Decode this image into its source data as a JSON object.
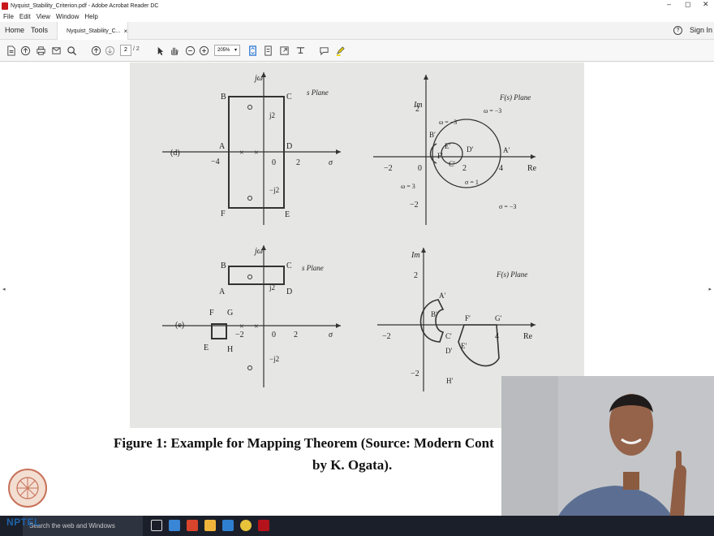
{
  "window": {
    "title": "Nyquist_Stability_Criterion.pdf - Adobe Acrobat Reader DC",
    "controls": {
      "minimize": "–",
      "maximize": "◻",
      "close": "✕"
    }
  },
  "menu": {
    "items": [
      "File",
      "Edit",
      "View",
      "Window",
      "Help"
    ]
  },
  "tabs": {
    "home": "Home",
    "tools": "Tools",
    "document": "Nyquist_Stability_C...",
    "close": "×"
  },
  "account": {
    "help": "?",
    "signin": "Sign In"
  },
  "toolbar": {
    "page_current": "2",
    "page_total": "/ 2",
    "zoom": "205%"
  },
  "figure": {
    "d": {
      "label": "(d)",
      "s_plane": {
        "title": "s Plane",
        "jw": "jω",
        "sigma": "σ",
        "labels": {
          "A": "A",
          "B": "B",
          "C": "C",
          "D": "D",
          "E": "E",
          "F": "F"
        },
        "ticks": {
          "minus4": "−4",
          "zero": "0",
          "two": "2",
          "j2": "j2",
          "mj2": "−j2"
        }
      },
      "f_plane": {
        "title": "F(s) Plane",
        "im": "Im",
        "re": "Re",
        "ticks": {
          "two": "2",
          "minus2": "−2",
          "zero": "0",
          "x2": "2",
          "x4": "4",
          "xm2": "−2"
        },
        "labels": {
          "A": "A′",
          "B": "B′",
          "C": "C′",
          "D": "D′",
          "E": "E′",
          "F": "F′"
        },
        "annotations": {
          "w_m3_top": "ω = −3",
          "w_m3_inner": "ω = −3",
          "w_3": "ω = 3",
          "sigma_1": "σ = 1",
          "sigma_m3": "σ = −3"
        }
      }
    },
    "e": {
      "label": "(e)",
      "s_plane": {
        "title": "s Plane",
        "jw": "jω",
        "sigma": "σ",
        "labels": {
          "A": "A",
          "B": "B",
          "C": "C",
          "D": "D",
          "E": "E",
          "F": "F",
          "G": "G",
          "H": "H"
        },
        "ticks": {
          "minus2": "−2",
          "zero": "0",
          "two": "2",
          "j2": "j2",
          "mj2": "−j2"
        }
      },
      "f_plane": {
        "title": "F(s) Plane",
        "im": "Im",
        "re": "Re",
        "ticks": {
          "two": "2",
          "minus2": "−2",
          "xm2": "−2",
          "x4": "4"
        },
        "labels": {
          "A": "A′",
          "B": "B′",
          "C": "C′",
          "D": "D′",
          "E": "E′",
          "F": "F′",
          "G": "G′",
          "H": "H′"
        }
      }
    }
  },
  "caption": {
    "line1": "Figure 1: Example for Mapping Theorem (Source: Modern Cont",
    "line2": "by K. Ogata)."
  },
  "taskbar": {
    "search": "Search the web and Windows"
  },
  "watermark": {
    "text": "NPTEL"
  }
}
